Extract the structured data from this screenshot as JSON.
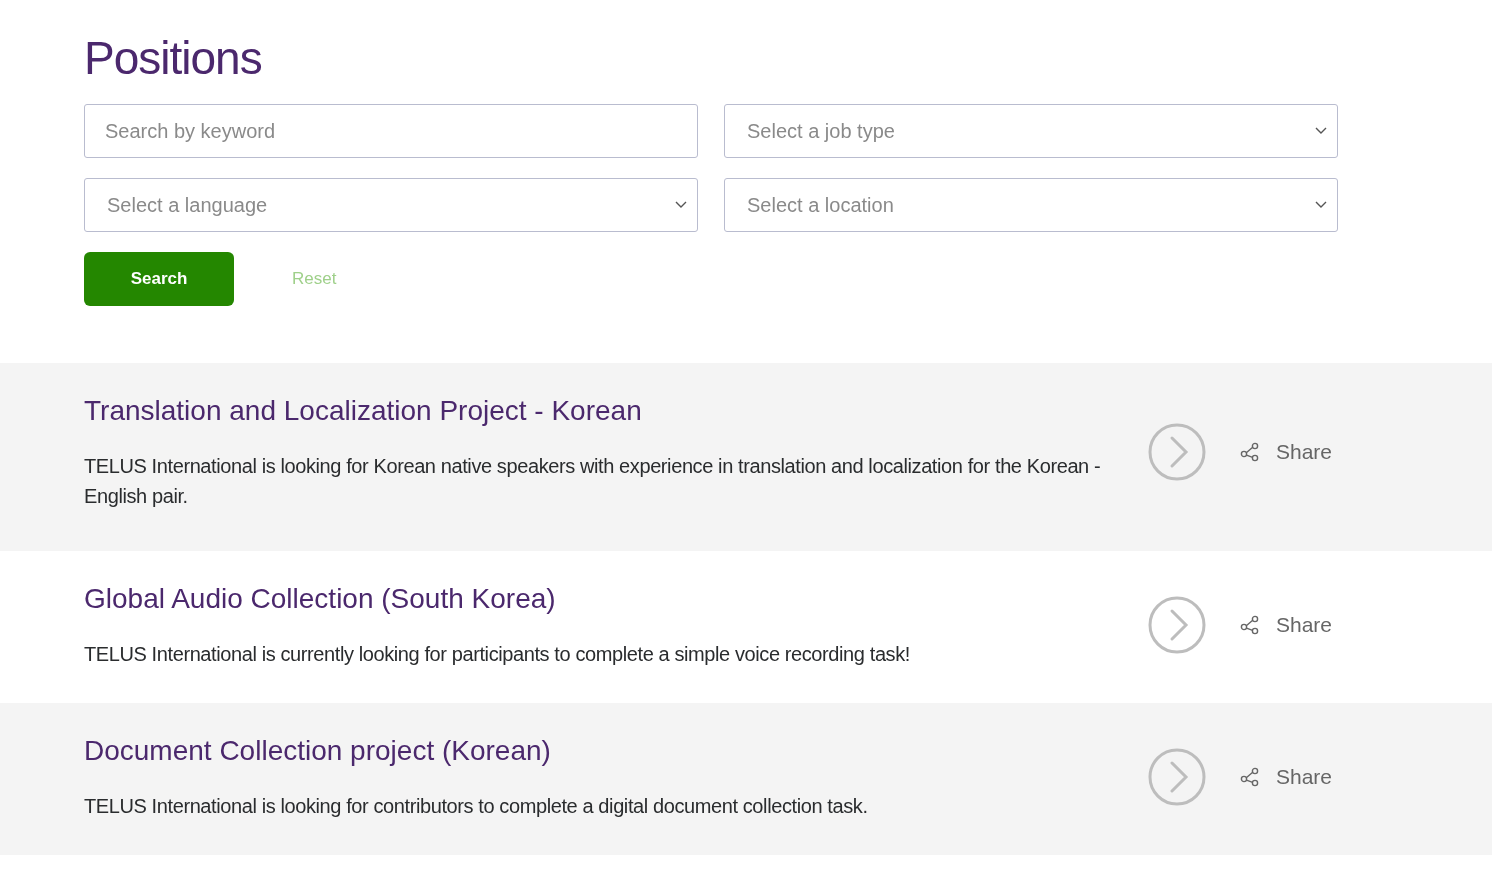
{
  "title": "Positions",
  "filters": [
    {
      "kind": "input",
      "placeholder": "Search by keyword"
    },
    {
      "kind": "select",
      "placeholder": "Select a job type"
    },
    {
      "kind": "select",
      "placeholder": "Select a language"
    },
    {
      "kind": "select",
      "placeholder": "Select a location"
    }
  ],
  "search_button": "Search",
  "reset_link": "Reset",
  "positions": [
    {
      "title": "Translation and Localization Project - Korean",
      "description": "TELUS International is looking for Korean native speakers with experience in translation and localization for the Korean - English pair.",
      "share": "Share"
    },
    {
      "title": "Global Audio Collection (South Korea)",
      "description": "TELUS International is currently looking for participants to complete a simple voice recording task!",
      "share": "Share"
    },
    {
      "title": "Document Collection project (Korean)",
      "description": "TELUS International is looking for contributors to complete a digital document collection task.",
      "share": "Share"
    }
  ]
}
